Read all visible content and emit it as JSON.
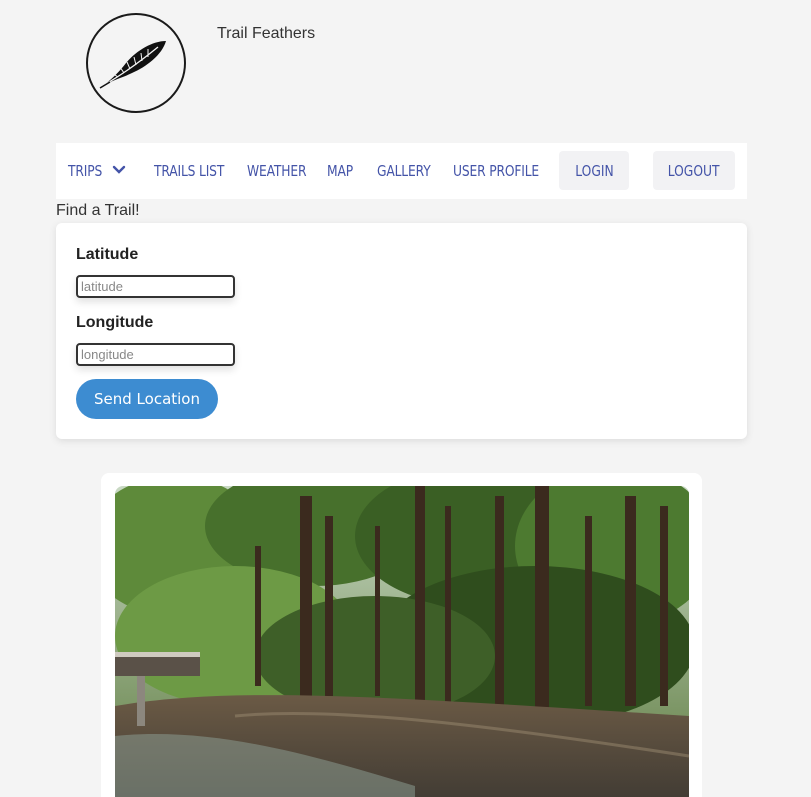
{
  "site": {
    "title": "Trail Feathers",
    "logo_icon": "feather-icon"
  },
  "nav": {
    "trips": "TRIPS",
    "trails_list": "TRAILS LIST",
    "weather": "WEATHER",
    "map": "MAP",
    "gallery": "GALLERY",
    "user_profile": "USER PROFILE",
    "login": "LOGIN",
    "logout": "LOGOUT",
    "dropdown_icon": "chevron-down-icon"
  },
  "finder": {
    "heading": "Find a Trail!",
    "latitude_label": "Latitude",
    "latitude_placeholder": "latitude",
    "longitude_label": "Longitude",
    "longitude_placeholder": "longitude",
    "submit_label": "Send Location"
  },
  "colors": {
    "nav_text": "#4454a8",
    "button_bg": "#3d8cd1",
    "page_bg": "#f4f4f4"
  },
  "photo": {
    "subject": "forest-trail-photo"
  }
}
